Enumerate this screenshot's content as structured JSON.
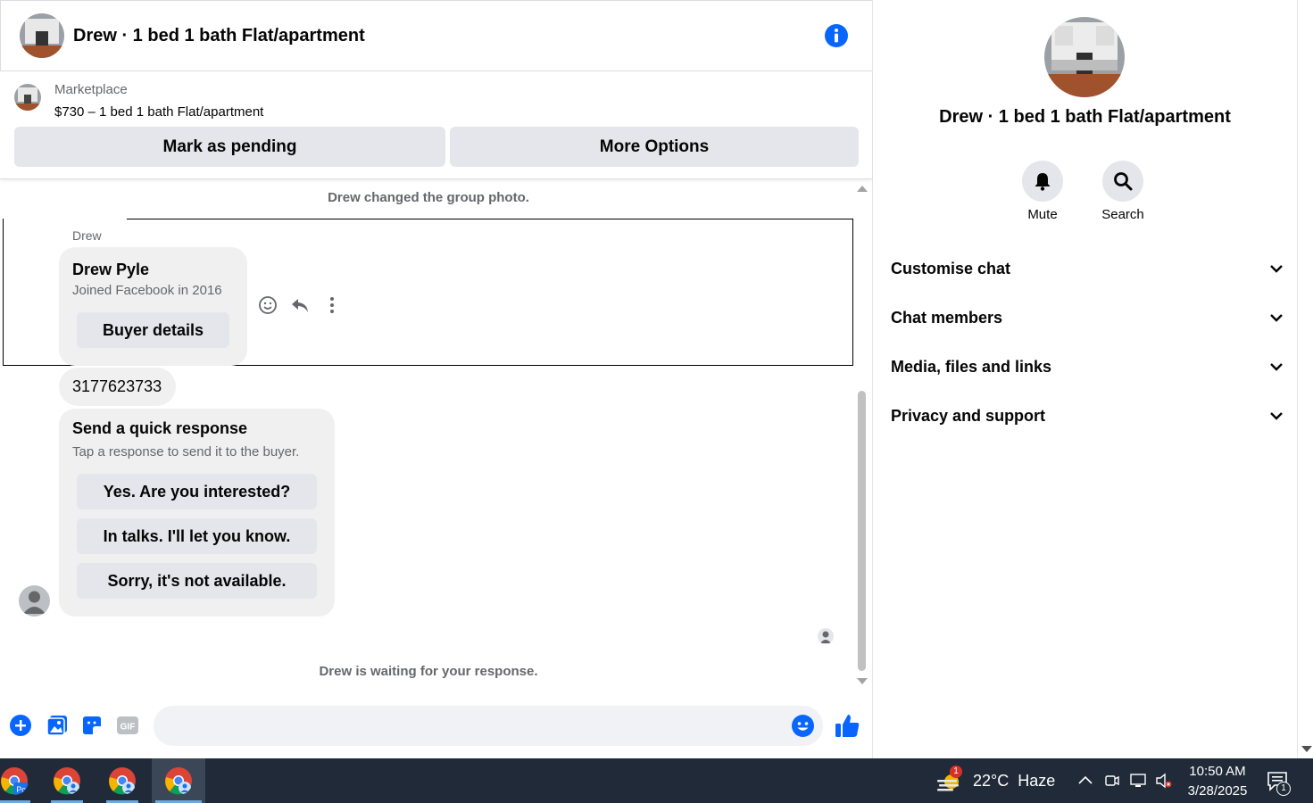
{
  "conversation": {
    "title": "Drew · 1 bed 1 bath Flat/apartment",
    "marketplace_label": "Marketplace",
    "listing": "$730 – 1 bed 1 bath Flat/apartment",
    "mark_pending_label": "Mark as pending",
    "more_options_label": "More Options"
  },
  "thread": {
    "system_top": "Drew changed the group photo.",
    "sender": "Drew",
    "profile_name": "Drew Pyle",
    "profile_joined": "Joined Facebook in 2016",
    "buyer_details_label": "Buyer details",
    "phone_message": "3177623733",
    "quick_title": "Send a quick response",
    "quick_subtitle": "Tap a response to send it to the buyer.",
    "quick_responses": [
      "Yes. Are you interested?",
      "In talks. I'll let you know.",
      "Sorry, it's not available."
    ],
    "system_bottom": "Drew is waiting for your response."
  },
  "composer": {
    "placeholder": "",
    "icons": [
      "plus-circle-icon",
      "image-icon",
      "sticker-icon",
      "gif-icon",
      "emoji-icon",
      "thumbs-up-icon"
    ]
  },
  "info_panel": {
    "title": "Drew · 1 bed 1 bath Flat/apartment",
    "actions": [
      {
        "label": "Mute",
        "icon": "bell-icon"
      },
      {
        "label": "Search",
        "icon": "search-icon"
      }
    ],
    "sections": [
      "Customise chat",
      "Chat members",
      "Media, files and links",
      "Privacy and support"
    ]
  },
  "taskbar": {
    "weather_badge": "1",
    "weather": "22°C  Haze",
    "time": "10:50 AM",
    "date": "3/28/2025",
    "notification_count": "1"
  },
  "colors": {
    "accent": "#0866ff",
    "button_bg": "#e4e6eb",
    "bubble_bg": "#f0f0f0",
    "secondary_text": "#65676b",
    "taskbar": "#202a38"
  }
}
